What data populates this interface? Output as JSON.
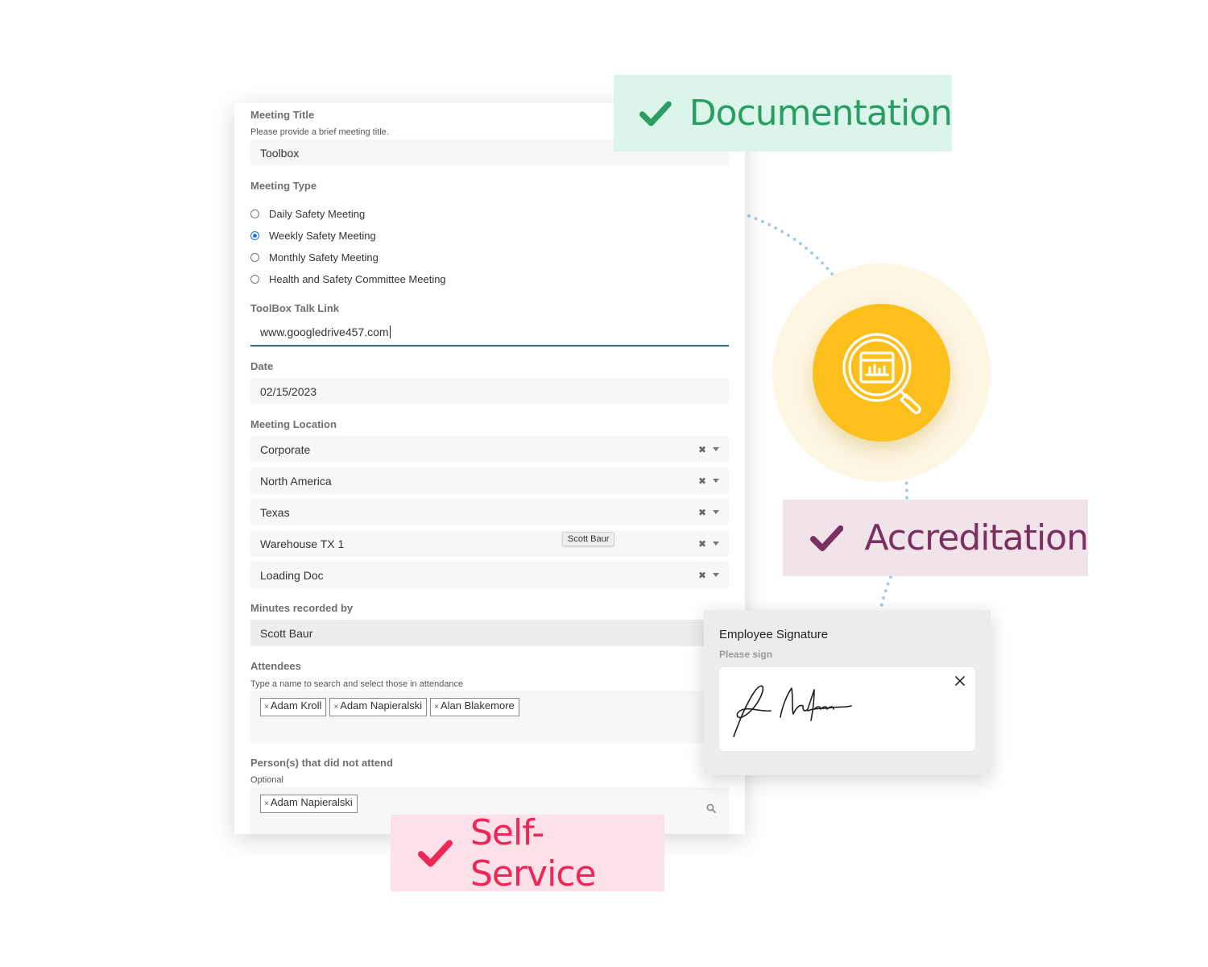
{
  "form": {
    "meeting_title": {
      "label": "Meeting Title",
      "help": "Please provide a brief meeting title.",
      "value": "Toolbox"
    },
    "meeting_type": {
      "label": "Meeting Type",
      "options": [
        {
          "label": "Daily Safety Meeting",
          "selected": false
        },
        {
          "label": "Weekly Safety Meeting",
          "selected": true
        },
        {
          "label": "Monthly Safety Meeting",
          "selected": false
        },
        {
          "label": "Health and Safety Committee Meeting",
          "selected": false
        }
      ]
    },
    "toolbox_link": {
      "label": "ToolBox Talk Link",
      "value": "www.googledrive457.com"
    },
    "date": {
      "label": "Date",
      "value": "02/15/2023"
    },
    "meeting_location": {
      "label": "Meeting Location",
      "levels": [
        "Corporate",
        "North America",
        "Texas",
        "Warehouse TX 1",
        "Loading Doc"
      ],
      "tooltip": "Scott Baur"
    },
    "minutes_recorded_by": {
      "label": "Minutes recorded by",
      "value": "Scott Baur"
    },
    "attendees": {
      "label": "Attendees",
      "help": "Type a name to search and select those in attendance",
      "tags": [
        "Adam Kroll",
        "Adam Napieralski",
        "Alan Blakemore"
      ]
    },
    "not_attended": {
      "label": "Person(s) that did not attend",
      "help": "Optional",
      "tags": [
        "Adam Napieralski"
      ]
    },
    "tag_remove_glyph": "×",
    "select_clear_glyph": "✖"
  },
  "badges": {
    "documentation": {
      "label": "Documentation",
      "color": "#2a9d64",
      "bg": "#dcf5ea"
    },
    "accreditation": {
      "label": "Accreditation",
      "color": "#7b3060",
      "bg": "#f1e3ea"
    },
    "self_service": {
      "label": "Self-Service",
      "color": "#ef2657",
      "bg": "#fde1e8"
    }
  },
  "signature": {
    "title": "Employee Signature",
    "subtitle": "Please sign"
  },
  "icons": {
    "badge_check": "check-icon",
    "center": "magnifier-chart-icon",
    "signature_close": "close-icon",
    "search": "search-icon"
  }
}
